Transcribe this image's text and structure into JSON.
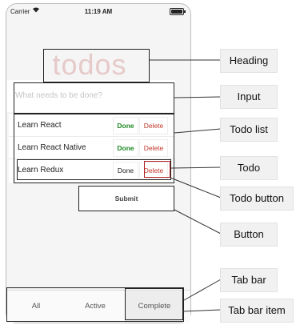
{
  "status_bar": {
    "carrier": "Carrier",
    "time": "11:19 AM"
  },
  "app": {
    "title": "todos",
    "input_placeholder": "What needs to be done?",
    "todos": [
      {
        "label": "Learn React",
        "done_label": "Done",
        "delete_label": "Delete",
        "complete": true
      },
      {
        "label": "Learn React Native",
        "done_label": "Done",
        "delete_label": "Delete",
        "complete": true
      },
      {
        "label": "Learn Redux",
        "done_label": "Done",
        "delete_label": "Delete",
        "complete": false
      }
    ],
    "submit_label": "Submit",
    "tabs": [
      {
        "label": "All"
      },
      {
        "label": "Active"
      },
      {
        "label": "Complete",
        "selected": true
      }
    ]
  },
  "annotations": {
    "heading": "Heading",
    "input": "Input",
    "todo_list": "Todo list",
    "todo": "Todo",
    "todo_button": "Todo button",
    "button": "Button",
    "tab_bar": "Tab bar",
    "tab_bar_item": "Tab bar item"
  },
  "colors": {
    "done_complete": "#1e8a23",
    "delete": "#c0392b",
    "delete_highlight": "#b22222",
    "title": "#c86e6e",
    "callout_bg": "#f1f1f1"
  }
}
